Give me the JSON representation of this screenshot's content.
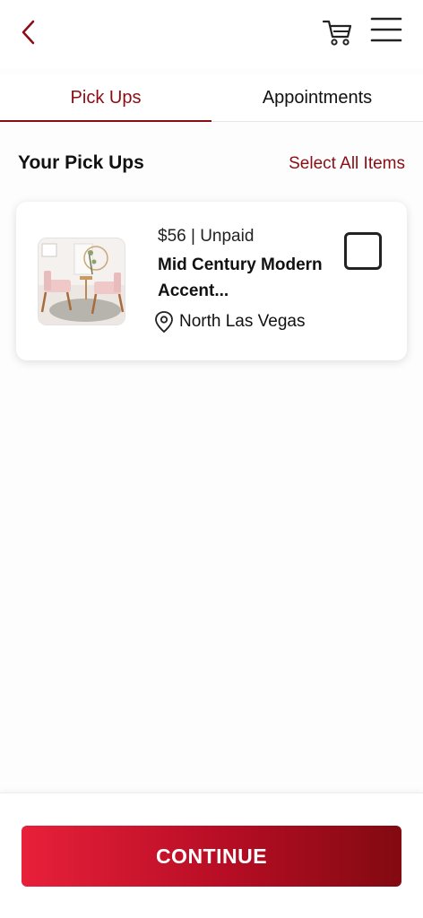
{
  "header": {
    "back_icon": "chevron-left-icon",
    "cart_icon": "cart-icon",
    "menu_icon": "hamburger-menu-icon",
    "accent_color": "#8b0d14"
  },
  "tabs": [
    {
      "label": "Pick Ups",
      "active": true
    },
    {
      "label": "Appointments",
      "active": false
    }
  ],
  "section": {
    "title": "Your Pick Ups",
    "select_all_label": "Select All Items"
  },
  "items": [
    {
      "price_status": "$56 | Unpaid",
      "title": "Mid Century Modern Accent...",
      "location": "North Las Vegas",
      "location_icon": "map-pin-icon",
      "checked": false
    }
  ],
  "footer": {
    "continue_label": "CONTINUE",
    "button_gradient": [
      "#e8203a",
      "#820a10"
    ]
  }
}
